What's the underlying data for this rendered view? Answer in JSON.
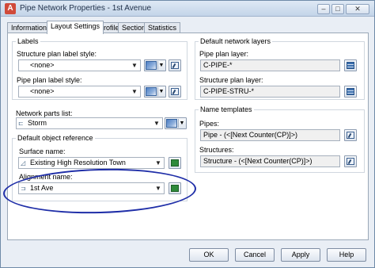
{
  "window": {
    "title": "Pipe Network Properties - 1st Avenue",
    "app_icon_letter": "A",
    "controls": {
      "minimize": "–",
      "maximize": "□",
      "close": "✕"
    }
  },
  "tabs": [
    "Information",
    "Layout Settings",
    "Profile",
    "Section",
    "Statistics"
  ],
  "active_tab": "Layout Settings",
  "labels_group": {
    "title": "Labels",
    "structure_label": "Structure plan label style:",
    "structure_value": "<none>",
    "pipe_label": "Pipe plan label style:",
    "pipe_value": "<none>"
  },
  "network_parts": {
    "label": "Network parts list:",
    "value": "Storm"
  },
  "default_object_reference": {
    "title": "Default object reference",
    "surface_label": "Surface name:",
    "surface_value": "Existing High Resolution Town",
    "alignment_label": "Alignment name:",
    "alignment_value": "1st Ave"
  },
  "default_network_layers": {
    "title": "Default network layers",
    "pipe_layer_label": "Pipe plan layer:",
    "pipe_layer_value": "C-PIPE-*",
    "structure_layer_label": "Structure plan layer:",
    "structure_layer_value": "C-PIPE-STRU-*"
  },
  "name_templates": {
    "title": "Name templates",
    "pipes_label": "Pipes:",
    "pipes_value": "Pipe - (<[Next Counter(CP)]>)",
    "structures_label": "Structures:",
    "structures_value": "Structure - (<[Next Counter(CP)]>)"
  },
  "buttons": {
    "ok": "OK",
    "cancel": "Cancel",
    "apply": "Apply",
    "help": "Help"
  },
  "annotation_color": "#1f2ea8"
}
